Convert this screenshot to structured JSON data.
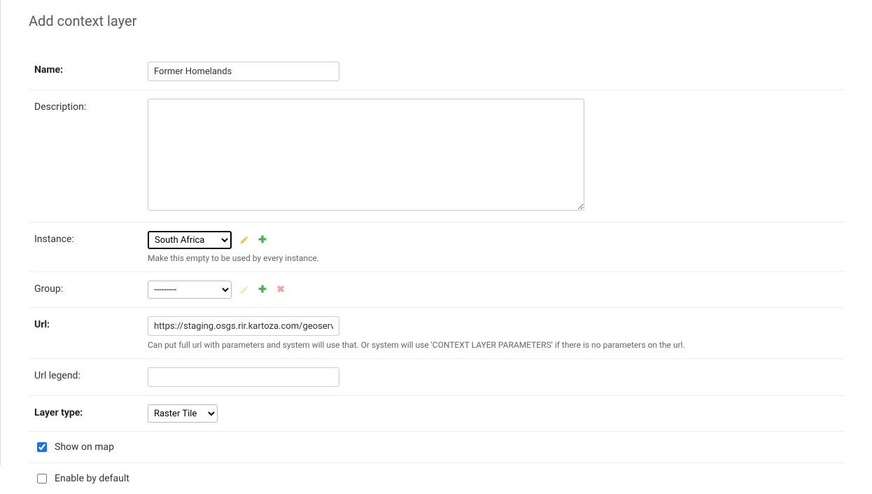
{
  "page": {
    "title": "Add context layer"
  },
  "fields": {
    "name": {
      "label": "Name:",
      "value": "Former Homelands"
    },
    "description": {
      "label": "Description:",
      "value": ""
    },
    "instance": {
      "label": "Instance:",
      "selected": "South Africa",
      "options": [
        "South Africa"
      ],
      "help": "Make this empty to be used by every instance."
    },
    "group": {
      "label": "Group:",
      "selected": "---------",
      "options": [
        "---------"
      ]
    },
    "url": {
      "label": "Url:",
      "value": "https://staging.osgs.rir.kartoza.com/geoserver",
      "help": "Can put full url with parameters and system will use that. Or system will use 'CONTEXT LAYER PARAMETERS' if there is no parameters on the url."
    },
    "url_legend": {
      "label": "Url legend:",
      "value": ""
    },
    "layer_type": {
      "label": "Layer type:",
      "selected": "Raster Tile",
      "options": [
        "Raster Tile"
      ]
    },
    "show_on_map": {
      "label": "Show on map",
      "checked": true
    },
    "enable_by_default": {
      "label": "Enable by default",
      "checked": false
    }
  }
}
